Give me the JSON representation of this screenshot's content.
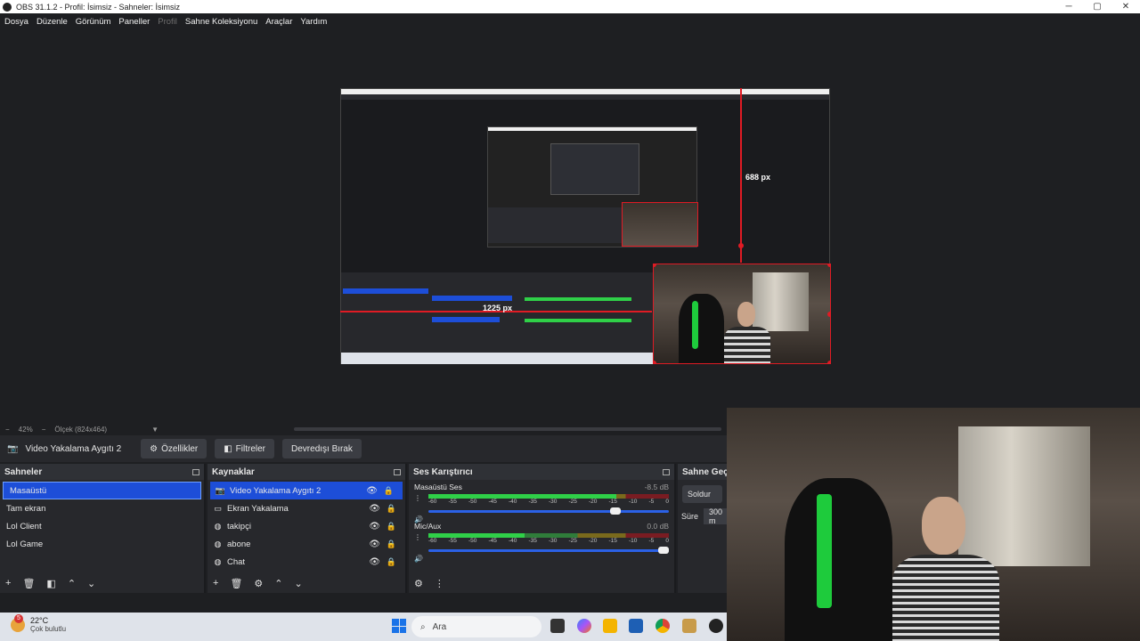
{
  "window": {
    "title": "OBS 31.1.2 - Profil: İsimsiz - Sahneler: İsimsiz",
    "controls": [
      "─",
      "▢",
      "✕"
    ]
  },
  "menu": {
    "items": [
      "Dosya",
      "Düzenle",
      "Görünüm",
      "Paneller",
      "Profil",
      "Sahne Koleksiyonu",
      "Araçlar",
      "Yardım"
    ],
    "disabled_index": 4
  },
  "preview": {
    "label_vertical": "688 px",
    "label_horizontal": "1225 px"
  },
  "zoombar": {
    "zoom": "42%",
    "scale": "Ölçek (824x464)"
  },
  "toolbar": {
    "source_name": "Video Yakalama Aygıtı 2",
    "properties": "Özellikler",
    "filters": "Filtreler",
    "deactivate": "Devredışı Bırak"
  },
  "scenes": {
    "title": "Sahneler",
    "items": [
      "Masaüstü",
      "Tam ekran",
      "Lol Client",
      "Lol Game"
    ]
  },
  "sources": {
    "title": "Kaynaklar",
    "items": [
      "Video Yakalama Aygıtı 2",
      "Ekran Yakalama",
      "takipçi",
      "abone",
      "Chat"
    ]
  },
  "mixer": {
    "title": "Ses Karıştırıcı",
    "ticks": [
      "-60",
      "-55",
      "-50",
      "-45",
      "-40",
      "-35",
      "-30",
      "-25",
      "-20",
      "-15",
      "-10",
      "-5",
      "0"
    ],
    "channels": [
      {
        "name": "Masaüstü Ses",
        "db": "-8.5 dB",
        "level": 0.78,
        "volume": 0.8
      },
      {
        "name": "Mic/Aux",
        "db": "0.0 dB",
        "level": 0.4,
        "volume": 1.0
      }
    ]
  },
  "transitions": {
    "title": "Sahne Geçiş",
    "selected": "Soldur",
    "duration_label": "Süre",
    "duration_value": "300 m"
  },
  "taskbar": {
    "weather_badge": "5",
    "temperature": "22°C",
    "condition": "Çok bulutlu",
    "search_placeholder": "Ara"
  },
  "colors": {
    "accent": "#1d4ed8",
    "selection": "#e01b24",
    "meter_green": "#2fd048"
  }
}
